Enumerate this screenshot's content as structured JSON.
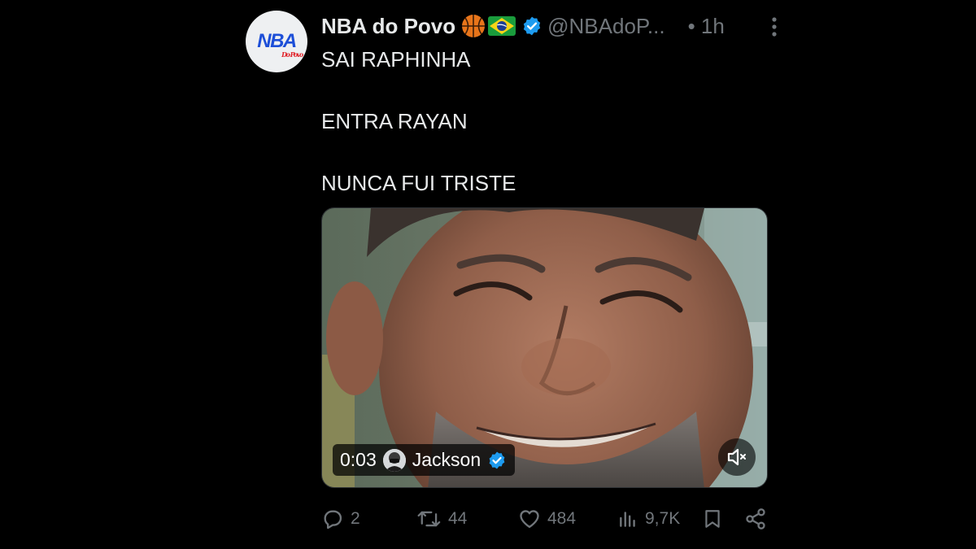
{
  "tweet": {
    "avatar_logo_main": "NBA",
    "avatar_logo_sub": "Do Povo",
    "display_name": "NBA do Povo",
    "emoji_icons": [
      "basketball-icon",
      "brazil-flag-icon"
    ],
    "handle": "@NBAdoP...",
    "time": "• 1h",
    "text_lines": [
      "SAI RAPHINHA",
      "ENTRA RAYAN",
      "NUNCA FUI TRISTE"
    ]
  },
  "media": {
    "elapsed": "0:03",
    "uploader": "Jackson",
    "mute_icon": "speaker-muted-icon"
  },
  "actions": {
    "replies": "2",
    "reposts": "44",
    "likes": "484",
    "views": "9,7K"
  },
  "colors": {
    "background": "#000000",
    "text": "#e7e9ea",
    "muted": "#71767b",
    "verified": "#1d9bf0"
  }
}
